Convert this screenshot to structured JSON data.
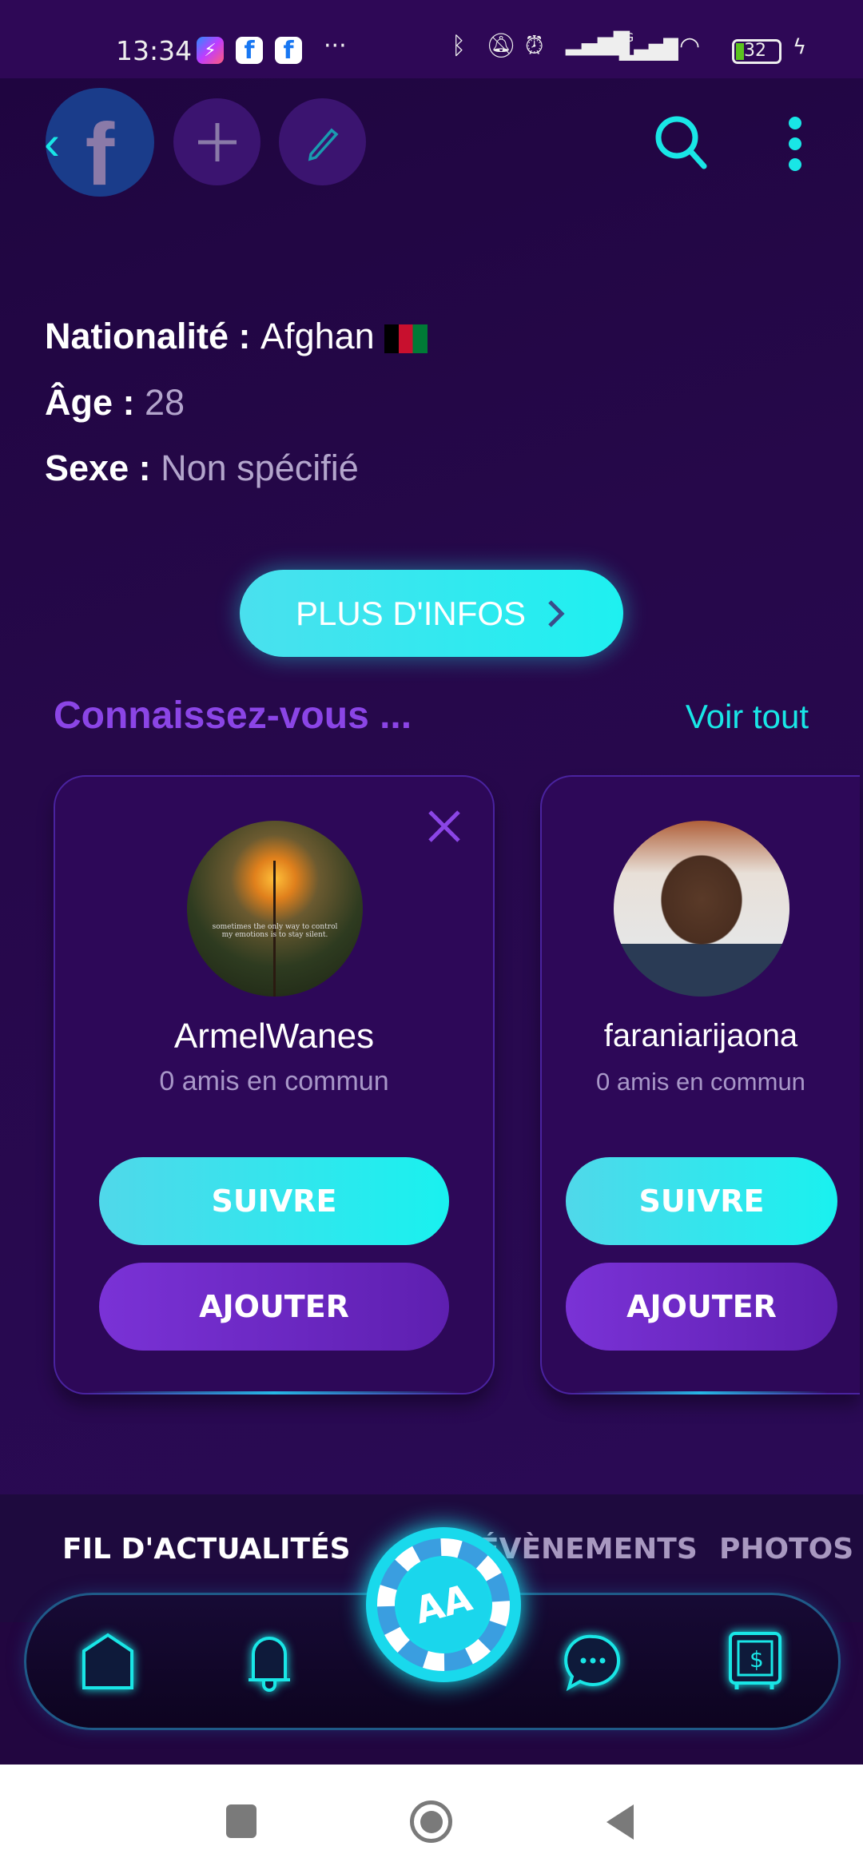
{
  "status_bar": {
    "time": "13:34",
    "battery": "32",
    "network": "4G",
    "notification_icons": [
      "messenger-icon",
      "facebook-icon",
      "facebook-icon"
    ],
    "more": "···"
  },
  "header": {
    "back_icon": "chevron-left-icon",
    "fb_letter": "f",
    "add_icon": "plus-icon",
    "edit_icon": "pencil-icon",
    "search_icon": "search-icon",
    "menu_icon": "more-vertical-icon"
  },
  "profile": {
    "nationality_label": "Nationalité :",
    "nationality_value": "Afghan",
    "age_label": "Âge :",
    "age_value": "28",
    "sex_label": "Sexe :",
    "sex_value": "Non spécifié",
    "more_info_button": "PLUS D'INFOS"
  },
  "suggestions": {
    "title": "Connaissez-vous ...",
    "see_all": "Voir tout",
    "cards": [
      {
        "name": "ArmelWanes",
        "mutual": "0 amis en commun",
        "follow": "SUIVRE",
        "add": "AJOUTER",
        "avatar_caption": "sometimes the only way to control my emotions is to stay silent."
      },
      {
        "name": "faraniarijaona",
        "mutual": "0 amis en commun",
        "follow": "SUIVRE",
        "add": "AJOUTER"
      }
    ]
  },
  "tabs": [
    {
      "label": "FIL D'ACTUALITÉS",
      "active": true
    },
    {
      "label": "ÉVÈNEMENTS",
      "active": false
    },
    {
      "label": "PHOTOS",
      "active": false
    }
  ],
  "bottom_nav": {
    "items": [
      "home-icon",
      "bell-icon",
      "logo-chip",
      "chat-icon",
      "safe-icon"
    ],
    "logo_text": "AA"
  },
  "colors": {
    "accent": "#19f1ef",
    "purple": "#8b45e6",
    "bg": "#220640"
  }
}
